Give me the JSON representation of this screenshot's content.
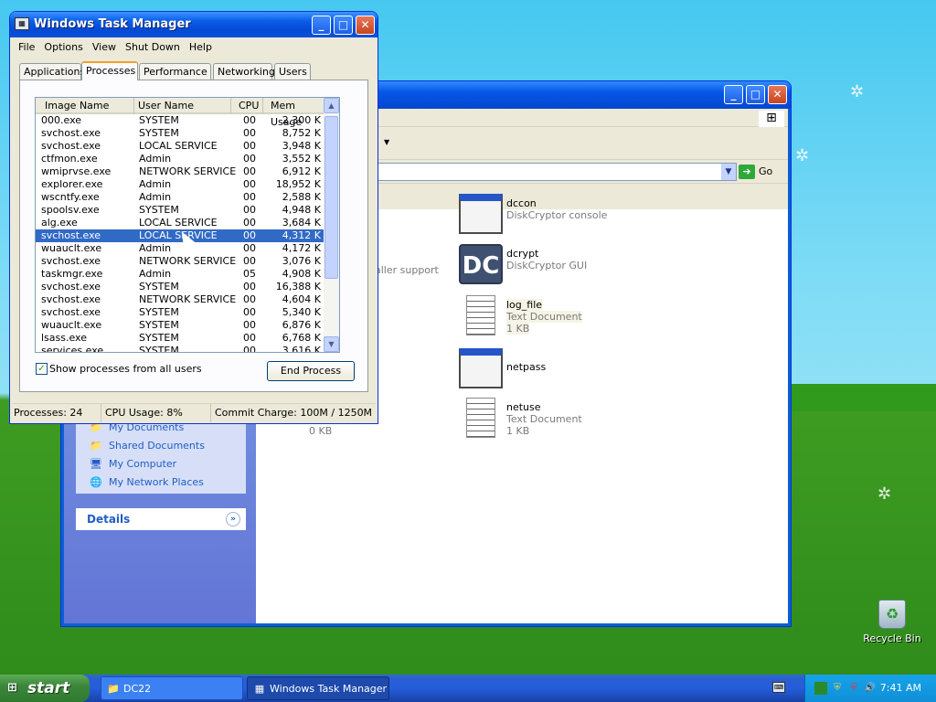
{
  "taskmanager": {
    "title": "Windows Task Manager",
    "menu": [
      "File",
      "Options",
      "View",
      "Shut Down",
      "Help"
    ],
    "tabs": [
      "Applications",
      "Processes",
      "Performance",
      "Networking",
      "Users"
    ],
    "active_tab": "Processes",
    "columns": [
      "Image Name",
      "User Name",
      "CPU",
      "Mem Usage"
    ],
    "processes": [
      {
        "name": "000.exe",
        "user": "SYSTEM",
        "cpu": "00",
        "mem": "2,300 K"
      },
      {
        "name": "svchost.exe",
        "user": "SYSTEM",
        "cpu": "00",
        "mem": "8,752 K"
      },
      {
        "name": "svchost.exe",
        "user": "LOCAL SERVICE",
        "cpu": "00",
        "mem": "3,948 K"
      },
      {
        "name": "ctfmon.exe",
        "user": "Admin",
        "cpu": "00",
        "mem": "3,552 K"
      },
      {
        "name": "wmiprvse.exe",
        "user": "NETWORK SERVICE",
        "cpu": "00",
        "mem": "6,912 K"
      },
      {
        "name": "explorer.exe",
        "user": "Admin",
        "cpu": "00",
        "mem": "18,952 K"
      },
      {
        "name": "wscntfy.exe",
        "user": "Admin",
        "cpu": "00",
        "mem": "2,588 K"
      },
      {
        "name": "spoolsv.exe",
        "user": "SYSTEM",
        "cpu": "00",
        "mem": "4,948 K"
      },
      {
        "name": "alg.exe",
        "user": "LOCAL SERVICE",
        "cpu": "00",
        "mem": "3,684 K"
      },
      {
        "name": "svchost.exe",
        "user": "LOCAL SERVICE",
        "cpu": "00",
        "mem": "4,312 K",
        "selected": true
      },
      {
        "name": "wuauclt.exe",
        "user": "Admin",
        "cpu": "00",
        "mem": "4,172 K"
      },
      {
        "name": "svchost.exe",
        "user": "NETWORK SERVICE",
        "cpu": "00",
        "mem": "3,076 K"
      },
      {
        "name": "taskmgr.exe",
        "user": "Admin",
        "cpu": "05",
        "mem": "4,908 K"
      },
      {
        "name": "svchost.exe",
        "user": "SYSTEM",
        "cpu": "00",
        "mem": "16,388 K"
      },
      {
        "name": "svchost.exe",
        "user": "NETWORK SERVICE",
        "cpu": "00",
        "mem": "4,604 K"
      },
      {
        "name": "svchost.exe",
        "user": "SYSTEM",
        "cpu": "00",
        "mem": "5,340 K"
      },
      {
        "name": "wuauclt.exe",
        "user": "SYSTEM",
        "cpu": "00",
        "mem": "6,876 K"
      },
      {
        "name": "lsass.exe",
        "user": "SYSTEM",
        "cpu": "00",
        "mem": "6,768 K"
      },
      {
        "name": "services.exe",
        "user": "SYSTEM",
        "cpu": "00",
        "mem": "3,616 K"
      }
    ],
    "show_all_label": "Show processes from all users",
    "show_all_checked": true,
    "end_process_label": "End Process",
    "status": {
      "processes": "Processes: 24",
      "cpu": "CPU Usage: 8%",
      "commit": "Commit Charge: 100M / 1250M"
    }
  },
  "explorer": {
    "go_label": "Go",
    "partial_text": "aller support",
    "partial_size": "0 KB",
    "places": [
      "My Documents",
      "Shared Documents",
      "My Computer",
      "My Network Places"
    ],
    "details_label": "Details",
    "files": [
      {
        "name": "dccon",
        "desc": "DiskCryptor console",
        "size": "",
        "icon": "app-window-icon"
      },
      {
        "name": "dcrypt",
        "desc": "DiskCryptor GUI",
        "size": "",
        "icon": "diskcryptor-icon"
      },
      {
        "name": "log_file",
        "desc": "Text Document",
        "size": "1 KB",
        "icon": "text-document-icon"
      },
      {
        "name": "netpass",
        "desc": "",
        "size": "",
        "icon": "app-window-icon"
      },
      {
        "name": "netuse",
        "desc": "Text Document",
        "size": "1 KB",
        "icon": "text-document-icon"
      }
    ]
  },
  "desktop": {
    "recycle_bin": "Recycle Bin"
  },
  "taskbar": {
    "start": "start",
    "buttons": [
      {
        "label": "DC22",
        "active": false
      },
      {
        "label": "Windows Task Manager",
        "active": true
      }
    ],
    "clock": "7:41 AM"
  },
  "colors": {
    "selection": "#316ac5",
    "xp_blue": "#0054e3",
    "start_green": "#3c873c"
  }
}
